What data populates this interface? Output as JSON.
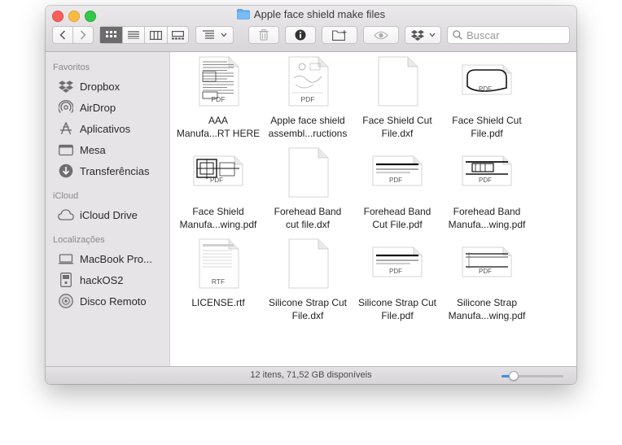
{
  "window": {
    "title": "Apple face shield make files"
  },
  "toolbar": {
    "search_placeholder": "Buscar",
    "view_icons": [
      "grid-view-icon",
      "list-view-icon",
      "column-view-icon",
      "gallery-view-icon"
    ],
    "selected_view": "icon"
  },
  "sidebar": {
    "favorites_title": "Favoritos",
    "favorites": [
      {
        "label": "Dropbox",
        "icon": "dropbox-icon"
      },
      {
        "label": "AirDrop",
        "icon": "airdrop-icon"
      },
      {
        "label": "Aplicativos",
        "icon": "applications-icon"
      },
      {
        "label": "Mesa",
        "icon": "desktop-icon"
      },
      {
        "label": "Transferências",
        "icon": "downloads-icon"
      }
    ],
    "icloud_title": "iCloud",
    "icloud": [
      {
        "label": "iCloud Drive",
        "icon": "cloud-icon"
      }
    ],
    "locations_title": "Localizações",
    "locations": [
      {
        "label": "MacBook Pro...",
        "icon": "laptop-icon"
      },
      {
        "label": "hackOS2",
        "icon": "disk-icon"
      },
      {
        "label": "Disco Remoto",
        "icon": "optical-disc-icon"
      }
    ]
  },
  "files": [
    {
      "line1": "AAA",
      "line2": "Manufa...RT HERE",
      "badge": "PDF",
      "thumb": "doc"
    },
    {
      "line1": "Apple face shield",
      "line2": "assembl...ructions",
      "badge": "PDF",
      "thumb": "sketch"
    },
    {
      "line1": "Face Shield Cut",
      "line2": "File.dxf",
      "badge": "",
      "thumb": "blank"
    },
    {
      "line1": "Face Shield Cut",
      "line2": "File.pdf",
      "badge": "PDF",
      "thumb": "shield"
    },
    {
      "line1": "Face Shield",
      "line2": "Manufa...wing.pdf",
      "badge": "PDF",
      "thumb": "drawing"
    },
    {
      "line1": "Forehead Band",
      "line2": "cut file.dxf",
      "badge": "",
      "thumb": "blank"
    },
    {
      "line1": "Forehead Band",
      "line2": "Cut File.pdf",
      "badge": "PDF",
      "thumb": "band"
    },
    {
      "line1": "Forehead Band",
      "line2": "Manufa...wing.pdf",
      "badge": "PDF",
      "thumb": "banddrawing"
    },
    {
      "line1": "LICENSE.rtf",
      "line2": "",
      "badge": "RTF",
      "thumb": "rtf"
    },
    {
      "line1": "Silicone Strap Cut",
      "line2": "File.dxf",
      "badge": "",
      "thumb": "blank"
    },
    {
      "line1": "Silicone Strap Cut",
      "line2": "File.pdf",
      "badge": "PDF",
      "thumb": "band"
    },
    {
      "line1": "Silicone Strap",
      "line2": "Manufa...wing.pdf",
      "badge": "PDF",
      "thumb": "strapdrawing"
    }
  ],
  "status": {
    "text": "12 itens, 71,52 GB disponíveis",
    "zoom_fraction": 0.2
  },
  "colors": {
    "accent": "#3b8eea",
    "sidebar_bg": "#e6e4e6",
    "folder": "#5eaaf0"
  }
}
